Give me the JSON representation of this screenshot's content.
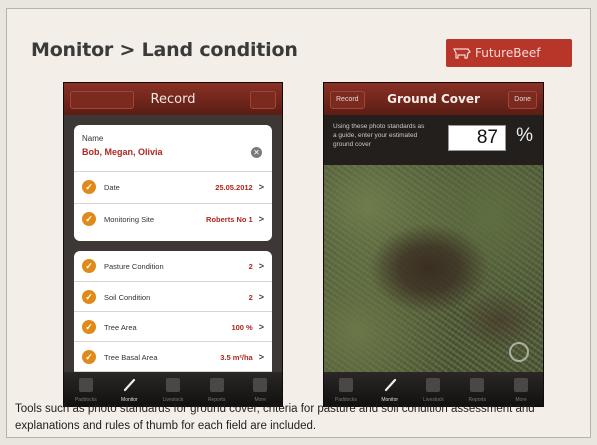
{
  "slide": {
    "title": "Monitor > Land condition",
    "logo_text": "FutureBeef",
    "caption": "Tools such as photo standards for ground cover, criteria for pasture and soil condition assessment and explanations and rules of thumb for each field are included."
  },
  "left_phone": {
    "nav": {
      "back_label": "",
      "title": "Record",
      "right_label": ""
    },
    "name_label": "Name",
    "name_value": "Bob, Megan, Olivia",
    "card1_rows": [
      {
        "label": "Date",
        "value": "25.05.2012"
      },
      {
        "label": "Monitoring Site",
        "value": "Roberts No 1"
      }
    ],
    "card2_rows": [
      {
        "label": "Pasture Condition",
        "value": "2"
      },
      {
        "label": "Soil Condition",
        "value": "2"
      },
      {
        "label": "Tree Area",
        "value": "100 %"
      },
      {
        "label": "Tree Basal Area",
        "value": "3.5 m²/ha"
      }
    ],
    "tabs": [
      "Paddocks",
      "Monitor",
      "Livestock",
      "Reports",
      "More"
    ]
  },
  "right_phone": {
    "nav": {
      "back_label": "Record",
      "title": "Ground Cover",
      "right_label": "Done"
    },
    "info_text": "Using these photo standards as a guide, enter your estimated ground cover",
    "percent_value": "87",
    "percent_sign": "%",
    "tabs": [
      "Paddocks",
      "Monitor",
      "Livestock",
      "Reports",
      "More"
    ]
  },
  "colors": {
    "accent": "#b1261e",
    "nav": "#7a2a1f",
    "check": "#e08a1a"
  }
}
